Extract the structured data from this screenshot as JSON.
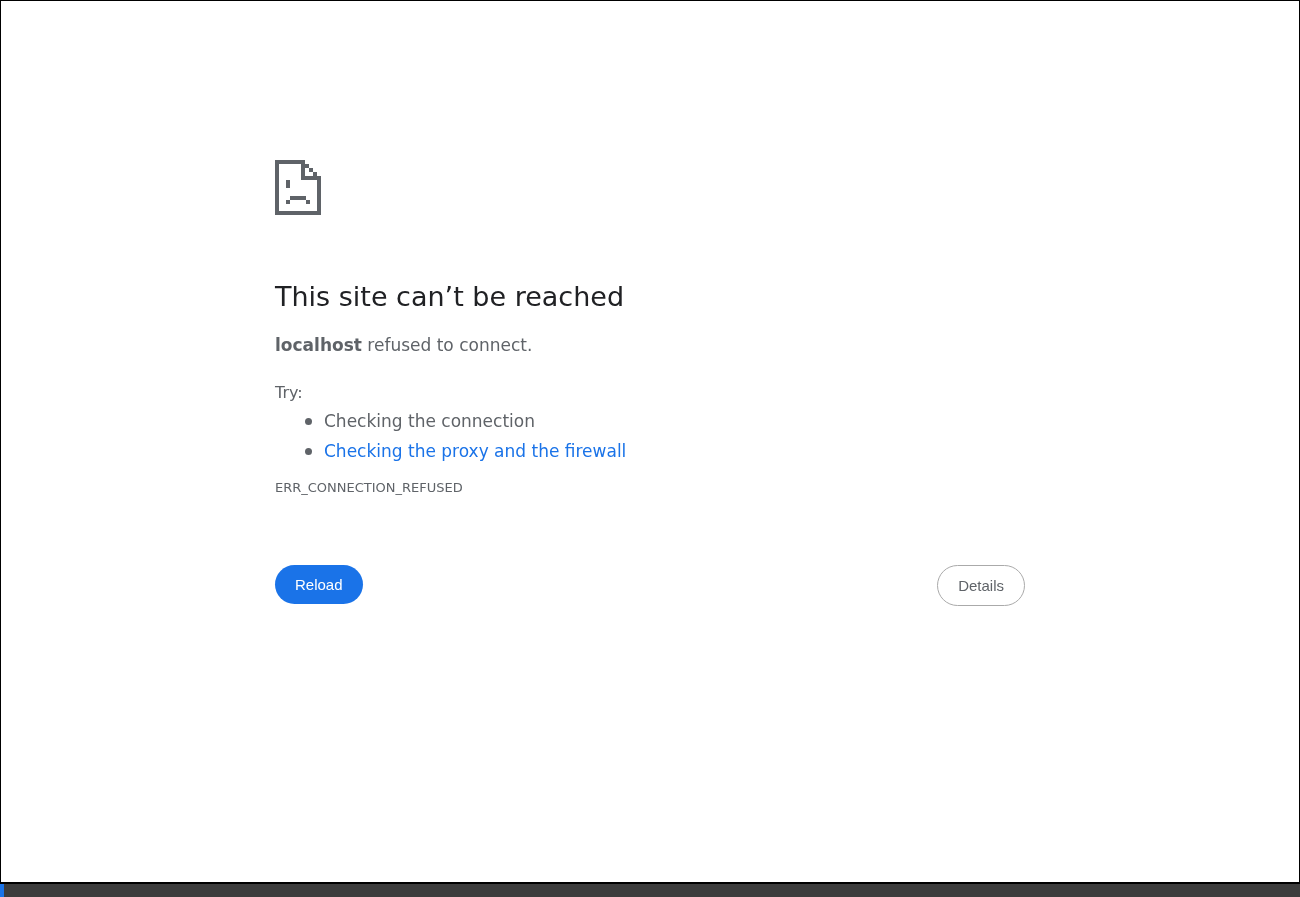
{
  "heading": "This site can’t be reached",
  "message": "**localhost** refused to connect.",
  "try_label": "Try:",
  "suggestions": [
    {
      "kind": "text",
      "text": "Checking the connection"
    },
    {
      "kind": "link",
      "text": "Checking the proxy and the firewall"
    }
  ],
  "error_code": "ERR_CONNECTION_REFUSED",
  "buttons": {
    "reload": "Reload",
    "details": "Details"
  }
}
